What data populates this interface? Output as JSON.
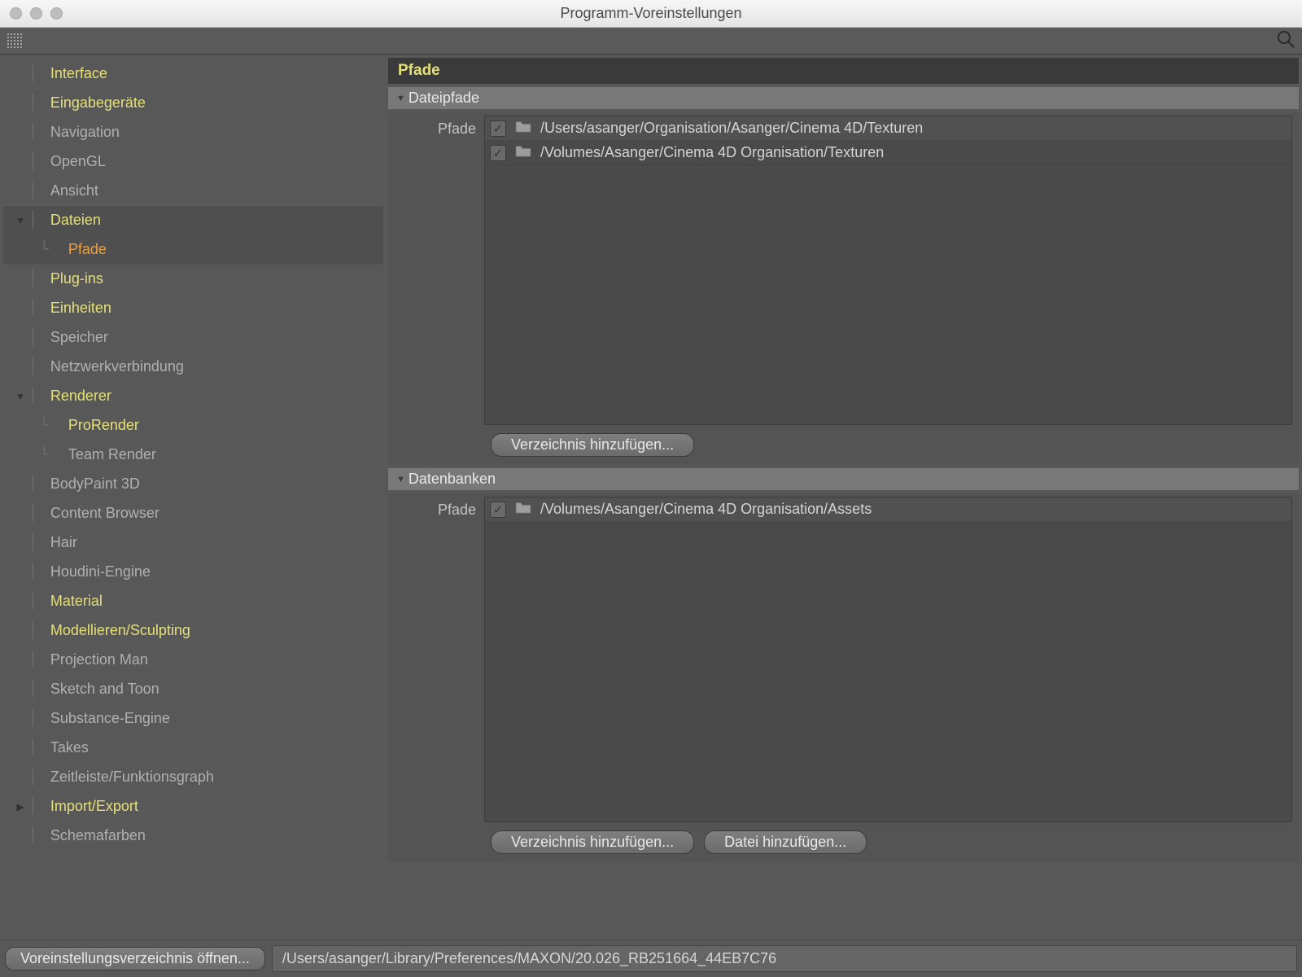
{
  "window": {
    "title": "Programm-Voreinstellungen"
  },
  "sidebar": {
    "items": [
      {
        "label": "Interface",
        "cls": "yellow",
        "indent": 0
      },
      {
        "label": "Eingabegeräte",
        "cls": "yellow",
        "indent": 0
      },
      {
        "label": "Navigation",
        "cls": "grey",
        "indent": 0
      },
      {
        "label": "OpenGL",
        "cls": "grey",
        "indent": 0
      },
      {
        "label": "Ansicht",
        "cls": "grey",
        "indent": 0
      },
      {
        "label": "Dateien",
        "cls": "yellow",
        "indent": 0,
        "twisty": "▼",
        "sel": true
      },
      {
        "label": "Pfade",
        "cls": "orange",
        "indent": 1,
        "sel": true
      },
      {
        "label": "Plug-ins",
        "cls": "yellow",
        "indent": 0
      },
      {
        "label": "Einheiten",
        "cls": "yellow",
        "indent": 0
      },
      {
        "label": "Speicher",
        "cls": "grey",
        "indent": 0
      },
      {
        "label": "Netzwerkverbindung",
        "cls": "grey",
        "indent": 0
      },
      {
        "label": "Renderer",
        "cls": "yellow",
        "indent": 0,
        "twisty": "▼"
      },
      {
        "label": "ProRender",
        "cls": "yellow",
        "indent": 1
      },
      {
        "label": "Team Render",
        "cls": "grey",
        "indent": 1
      },
      {
        "label": "BodyPaint 3D",
        "cls": "grey",
        "indent": 0
      },
      {
        "label": "Content Browser",
        "cls": "grey",
        "indent": 0
      },
      {
        "label": "Hair",
        "cls": "grey",
        "indent": 0
      },
      {
        "label": "Houdini-Engine",
        "cls": "grey",
        "indent": 0
      },
      {
        "label": "Material",
        "cls": "yellow",
        "indent": 0
      },
      {
        "label": "Modellieren/Sculpting",
        "cls": "yellow",
        "indent": 0
      },
      {
        "label": "Projection Man",
        "cls": "grey",
        "indent": 0
      },
      {
        "label": "Sketch and Toon",
        "cls": "grey",
        "indent": 0
      },
      {
        "label": "Substance-Engine",
        "cls": "grey",
        "indent": 0
      },
      {
        "label": "Takes",
        "cls": "grey",
        "indent": 0
      },
      {
        "label": "Zeitleiste/Funktionsgraph",
        "cls": "grey",
        "indent": 0
      },
      {
        "label": "Import/Export",
        "cls": "yellow",
        "indent": 0,
        "twisty": "▶"
      },
      {
        "label": "Schemafarben",
        "cls": "grey",
        "indent": 0
      }
    ]
  },
  "panel": {
    "title": "Pfade",
    "section1": {
      "name": "Dateipfade",
      "field_label": "Pfade",
      "paths": [
        "/Users/asanger/Organisation/Asanger/Cinema 4D/Texturen",
        "/Volumes/Asanger/Cinema 4D Organisation/Texturen"
      ],
      "add_button": "Verzeichnis hinzufügen..."
    },
    "section2": {
      "name": "Datenbanken",
      "field_label": "Pfade",
      "paths": [
        "/Volumes/Asanger/Cinema 4D Organisation/Assets"
      ],
      "add_dir_button": "Verzeichnis hinzufügen...",
      "add_file_button": "Datei hinzufügen..."
    }
  },
  "footer": {
    "open_button": "Voreinstellungsverzeichnis öffnen...",
    "path": "/Users/asanger/Library/Preferences/MAXON/20.026_RB251664_44EB7C76"
  }
}
